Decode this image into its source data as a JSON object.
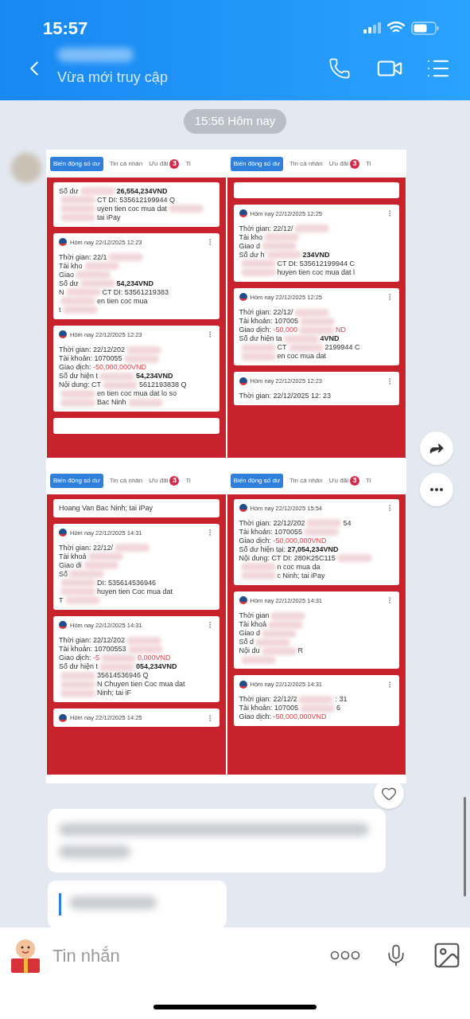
{
  "status_bar": {
    "time": "15:57"
  },
  "chat_header": {
    "subtitle": "Vừa mới truy cập"
  },
  "date_divider": "15:56 Hôm nay",
  "shared_photo": {
    "panels": [
      {
        "tabs": [
          {
            "label": "Biến động số dư",
            "selected": true
          },
          {
            "label": "Tin cá nhân",
            "selected": false
          },
          {
            "label": "Ưu đãi",
            "selected": false,
            "badge": "3"
          },
          {
            "label": "Ti",
            "selected": false
          }
        ],
        "cards": [
          {
            "lines": [
              [
                {
                  "kind": "text",
                  "text": "Số dư"
                },
                {
                  "kind": "blur"
                },
                {
                  "kind": "bold",
                  "text": "26,554,234VND"
                }
              ],
              [
                {
                  "kind": "blur"
                },
                {
                  "kind": "text",
                  "text": "CT DI: 535612199944 Q"
                }
              ],
              [
                {
                  "kind": "blur"
                },
                {
                  "kind": "text",
                  "text": "uyen tien coc mua dat"
                },
                {
                  "kind": "blur"
                }
              ],
              [
                {
                  "kind": "blur"
                },
                {
                  "kind": "text",
                  "text": "tai iPay"
                }
              ]
            ]
          },
          {
            "header": "Hôm nay 22/12/2025 12:23",
            "lines": [
              [
                {
                  "kind": "text",
                  "text": "Thời gian: 22/1"
                },
                {
                  "kind": "blur"
                }
              ],
              [
                {
                  "kind": "text",
                  "text": "Tài kho"
                },
                {
                  "kind": "blur"
                }
              ],
              [
                {
                  "kind": "text",
                  "text": "Giao"
                },
                {
                  "kind": "blur"
                }
              ],
              [
                {
                  "kind": "text",
                  "text": "Số dư"
                },
                {
                  "kind": "blur"
                },
                {
                  "kind": "bold",
                  "text": "54,234VND"
                }
              ],
              [
                {
                  "kind": "text",
                  "text": "N"
                },
                {
                  "kind": "blur"
                },
                {
                  "kind": "text",
                  "text": "CT DI: 53561219383"
                }
              ],
              [
                {
                  "kind": "blur"
                },
                {
                  "kind": "text",
                  "text": "en tien coc mua"
                }
              ],
              [
                {
                  "kind": "text",
                  "text": "t"
                },
                {
                  "kind": "blur"
                }
              ]
            ]
          },
          {
            "header": "Hôm nay 22/12/2025 12:23",
            "lines": [
              [
                {
                  "kind": "text",
                  "text": "Thời gian: 22/12/202"
                },
                {
                  "kind": "blur"
                }
              ],
              [
                {
                  "kind": "text",
                  "text": "Tài khoản: 1070055"
                },
                {
                  "kind": "blur"
                }
              ],
              [
                {
                  "kind": "text",
                  "text": "Giao dịch: "
                },
                {
                  "kind": "red",
                  "text": "-50,000,000VND"
                }
              ],
              [
                {
                  "kind": "text",
                  "text": "Số dư hiện t"
                },
                {
                  "kind": "blur"
                },
                {
                  "kind": "bold",
                  "text": "54,234VND"
                }
              ],
              [
                {
                  "kind": "text",
                  "text": "Nội dung: CT"
                },
                {
                  "kind": "blur"
                },
                {
                  "kind": "text",
                  "text": "5612193838 Q"
                }
              ],
              [
                {
                  "kind": "blur"
                },
                {
                  "kind": "text",
                  "text": "en tien coc mua dat lo so"
                }
              ],
              [
                {
                  "kind": "blur"
                },
                {
                  "kind": "text",
                  "text": "Bac Ninh"
                },
                {
                  "kind": "blur"
                }
              ]
            ]
          },
          {
            "kind": "cut_off"
          }
        ]
      },
      {
        "tabs": [
          {
            "label": "Biến động số dư",
            "selected": true
          },
          {
            "label": "Tin cá nhân",
            "selected": false
          },
          {
            "label": "Ưu đãi",
            "selected": false,
            "badge": "3"
          },
          {
            "label": "Ti",
            "selected": false
          }
        ],
        "cards": [
          {
            "kind": "cut_off"
          },
          {
            "header": "Hôm nay 22/12/2025 12:25",
            "lines": [
              [
                {
                  "kind": "text",
                  "text": "Thời gian: 22/12/"
                },
                {
                  "kind": "blur"
                }
              ],
              [
                {
                  "kind": "text",
                  "text": "Tài kho"
                },
                {
                  "kind": "blur"
                }
              ],
              [
                {
                  "kind": "text",
                  "text": "Giao d"
                },
                {
                  "kind": "blur"
                }
              ],
              [
                {
                  "kind": "text",
                  "text": "Số dư h"
                },
                {
                  "kind": "blur"
                },
                {
                  "kind": "bold",
                  "text": "234VND"
                }
              ],
              [
                {
                  "kind": "blur"
                },
                {
                  "kind": "text",
                  "text": "CT DI: 535612199944 C"
                }
              ],
              [
                {
                  "kind": "blur"
                },
                {
                  "kind": "text",
                  "text": "huyen tien coc mua dat l"
                }
              ]
            ]
          },
          {
            "header": "Hôm nay 22/12/2025 12:25",
            "lines": [
              [
                {
                  "kind": "text",
                  "text": "Thời gian: 22/12/"
                },
                {
                  "kind": "blur"
                }
              ],
              [
                {
                  "kind": "text",
                  "text": "Tài khoản: 107005"
                },
                {
                  "kind": "blur"
                }
              ],
              [
                {
                  "kind": "text",
                  "text": "Giao dịch: "
                },
                {
                  "kind": "red",
                  "text": "-50,000"
                },
                {
                  "kind": "blur"
                },
                {
                  "kind": "red",
                  "text": "ND"
                }
              ],
              [
                {
                  "kind": "text",
                  "text": "Số dư hiện ta"
                },
                {
                  "kind": "blur"
                },
                {
                  "kind": "bold",
                  "text": "4VND"
                }
              ],
              [
                {
                  "kind": "blur"
                },
                {
                  "kind": "text",
                  "text": "CT"
                },
                {
                  "kind": "blur"
                },
                {
                  "kind": "text",
                  "text": "2199944 C"
                }
              ],
              [
                {
                  "kind": "blur"
                },
                {
                  "kind": "text",
                  "text": "en coc mua dat"
                }
              ]
            ]
          },
          {
            "header": "Hôm nay 22/12/2025 12:23",
            "lines": [
              [
                {
                  "kind": "text",
                  "text": "Thời gian: 22/12/2025 12: 23"
                }
              ]
            ]
          }
        ]
      },
      {
        "tabs": [
          {
            "label": "Biến động số dư",
            "selected": true
          },
          {
            "label": "Tin cá nhân",
            "selected": false
          },
          {
            "label": "Ưu đãi",
            "selected": false,
            "badge": "3"
          },
          {
            "label": "Ti",
            "selected": false
          }
        ],
        "cards": [
          {
            "lines": [
              [
                {
                  "kind": "text",
                  "text": "Hoang Van Bac Ninh; tai iPay"
                }
              ]
            ]
          },
          {
            "header": "Hôm nay 22/12/2025 14:31",
            "lines": [
              [
                {
                  "kind": "text",
                  "text": "Thời gian: 22/12/"
                },
                {
                  "kind": "blur"
                }
              ],
              [
                {
                  "kind": "text",
                  "text": "Tài khoả"
                },
                {
                  "kind": "blur"
                }
              ],
              [
                {
                  "kind": "text",
                  "text": "Giao di"
                },
                {
                  "kind": "blur"
                }
              ],
              [
                {
                  "kind": "text",
                  "text": "Số"
                },
                {
                  "kind": "blur"
                }
              ],
              [
                {
                  "kind": "blur"
                },
                {
                  "kind": "text",
                  "text": "DI: 535614536946"
                }
              ],
              [
                {
                  "kind": "blur"
                },
                {
                  "kind": "text",
                  "text": "huyen tien Coc mua dat"
                }
              ],
              [
                {
                  "kind": "text",
                  "text": "T"
                },
                {
                  "kind": "blur"
                }
              ]
            ]
          },
          {
            "header": "Hôm nay 22/12/2025 14:31",
            "lines": [
              [
                {
                  "kind": "text",
                  "text": "Thời gian: 22/12/202"
                },
                {
                  "kind": "blur"
                }
              ],
              [
                {
                  "kind": "text",
                  "text": "Tài khoản: 10700553"
                },
                {
                  "kind": "blur"
                }
              ],
              [
                {
                  "kind": "text",
                  "text": "Giao dịch: "
                },
                {
                  "kind": "red",
                  "text": "-5"
                },
                {
                  "kind": "blur"
                },
                {
                  "kind": "red",
                  "text": "0,000VND"
                }
              ],
              [
                {
                  "kind": "text",
                  "text": "Số dư hiện t"
                },
                {
                  "kind": "blur"
                },
                {
                  "kind": "bold",
                  "text": "054,234VND"
                }
              ],
              [
                {
                  "kind": "blur"
                },
                {
                  "kind": "text",
                  "text": "35614536946 Q"
                }
              ],
              [
                {
                  "kind": "blur"
                },
                {
                  "kind": "text",
                  "text": "N Chuyen tien Coc mua dat"
                }
              ],
              [
                {
                  "kind": "blur"
                },
                {
                  "kind": "text",
                  "text": "Ninh; tai iF"
                }
              ]
            ]
          },
          {
            "header": "Hôm nay 22/12/2025 14:25"
          }
        ]
      },
      {
        "tabs": [
          {
            "label": "Biến động số dư",
            "selected": true
          },
          {
            "label": "Tin cá nhân",
            "selected": false
          },
          {
            "label": "Ưu đãi",
            "selected": false,
            "badge": "3"
          },
          {
            "label": "Ti",
            "selected": false
          }
        ],
        "cards": [
          {
            "header": "Hôm nay 22/12/2025 15:54",
            "lines": [
              [
                {
                  "kind": "text",
                  "text": "Thời gian: 22/12/202"
                },
                {
                  "kind": "blur"
                },
                {
                  "kind": "text",
                  "text": "54"
                }
              ],
              [
                {
                  "kind": "text",
                  "text": "Tài khoản: 1070055"
                },
                {
                  "kind": "blur"
                }
              ],
              [
                {
                  "kind": "text",
                  "text": "Giao dịch: "
                },
                {
                  "kind": "red",
                  "text": "-50,000,000VND"
                }
              ],
              [
                {
                  "kind": "text",
                  "text": "Số dư hiện tại: "
                },
                {
                  "kind": "bold",
                  "text": "27,054,234VND"
                }
              ],
              [
                {
                  "kind": "text",
                  "text": "Nội dung: CT DI: 280K25C115"
                },
                {
                  "kind": "blur"
                }
              ],
              [
                {
                  "kind": "blur"
                },
                {
                  "kind": "text",
                  "text": "n coc mua da"
                }
              ],
              [
                {
                  "kind": "blur"
                },
                {
                  "kind": "text",
                  "text": "c Ninh; tai iPay"
                }
              ]
            ]
          },
          {
            "header": "Hôm nay 22/12/2025 14:31",
            "lines": [
              [
                {
                  "kind": "text",
                  "text": "Thời gian"
                },
                {
                  "kind": "blur"
                }
              ],
              [
                {
                  "kind": "text",
                  "text": "Tài khoả"
                },
                {
                  "kind": "blur"
                }
              ],
              [
                {
                  "kind": "text",
                  "text": "Giao d"
                },
                {
                  "kind": "blur"
                }
              ],
              [
                {
                  "kind": "text",
                  "text": "Số d"
                },
                {
                  "kind": "blur"
                }
              ],
              [
                {
                  "kind": "text",
                  "text": "Nội du"
                },
                {
                  "kind": "blur"
                },
                {
                  "kind": "text",
                  "text": "R"
                }
              ],
              [
                {
                  "kind": "blur"
                }
              ]
            ]
          },
          {
            "header": "Hôm nay 22/12/2025 14:31",
            "lines": [
              [
                {
                  "kind": "text",
                  "text": "Thời gian: 22/12/2"
                },
                {
                  "kind": "blur"
                },
                {
                  "kind": "text",
                  "text": ": 31"
                }
              ],
              [
                {
                  "kind": "text",
                  "text": "Tài khoản: 107005"
                },
                {
                  "kind": "blur"
                },
                {
                  "kind": "text",
                  "text": "6"
                }
              ],
              [
                {
                  "kind": "text",
                  "text": "Giao dịch: "
                },
                {
                  "kind": "red",
                  "text": "-50,000,000VND"
                }
              ]
            ]
          }
        ]
      }
    ]
  },
  "composer": {
    "placeholder": "Tin nhắn"
  }
}
